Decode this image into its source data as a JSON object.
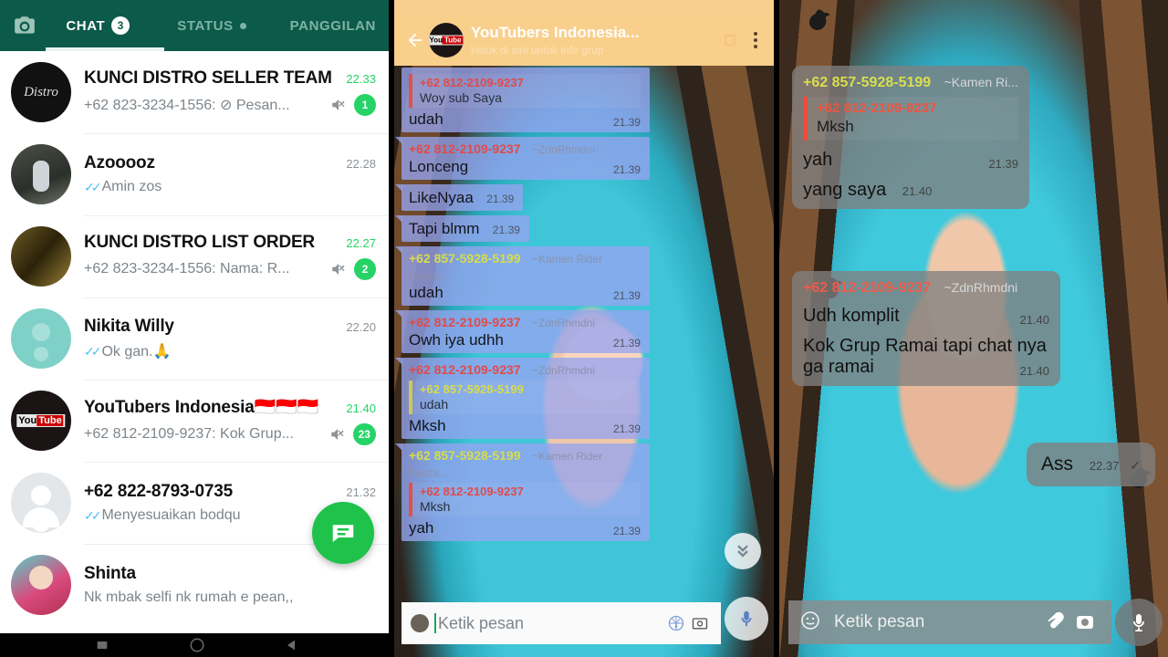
{
  "left_panel": {
    "header": {
      "camera_icon": "camera-icon",
      "tabs": [
        {
          "label": "CHAT",
          "badge": "3",
          "active": true
        },
        {
          "label": "STATUS",
          "dot": true,
          "active": false
        },
        {
          "label": "PANGGILAN",
          "active": false
        }
      ]
    },
    "chats": [
      {
        "name": "KUNCI DISTRO SELLER TEAM",
        "time": "22.33",
        "time_green": true,
        "preview": "+62 823-3234-1556: ⊘ Pesan...",
        "ticks": false,
        "muted": true,
        "unread": "1"
      },
      {
        "name": "Azooooz",
        "time": "22.28",
        "time_green": false,
        "preview": "Amin zos",
        "ticks": true,
        "muted": false,
        "unread": ""
      },
      {
        "name": "KUNCI DISTRO LIST ORDER",
        "time": "22.27",
        "time_green": true,
        "preview": "+62 823-3234-1556: Nama: R...",
        "ticks": false,
        "muted": true,
        "unread": "2"
      },
      {
        "name": "Nikita Willy",
        "time": "22.20",
        "time_green": false,
        "preview": "Ok gan.🙏",
        "ticks": true,
        "muted": false,
        "unread": ""
      },
      {
        "name": "YouTubers Indonesia🇮🇩🇮🇩🇮🇩",
        "time": "21.40",
        "time_green": true,
        "preview": "+62 812-2109-9237: Kok Grup...",
        "ticks": false,
        "muted": true,
        "unread": "23"
      },
      {
        "name": "+62 822-8793-0735",
        "time": "21.32",
        "time_green": false,
        "preview": "Menyesuaikan bodqu",
        "ticks": true,
        "muted": false,
        "unread": ""
      },
      {
        "name": "Shinta",
        "time": "",
        "time_green": false,
        "preview": "Nk mbak selfi nk rumah e pean,,",
        "ticks": false,
        "muted": false,
        "unread": ""
      }
    ],
    "fab": "new-chat-icon",
    "navbar": [
      "recents-icon",
      "home-icon",
      "back-icon"
    ]
  },
  "mid_panel": {
    "header": {
      "back_icon": "back-arrow-icon",
      "avatar": "youtube-logo",
      "title": "YouTubers Indonesia...",
      "subtitle": "ketuk di sini untuk info grup",
      "video_icon": "video-call-icon",
      "overflow_icon": "overflow-menu-icon"
    },
    "messages": [
      {
        "quote_sender": "+62 812-2109-9237",
        "quote_text": "Woy sub Saya",
        "quote_color": "red",
        "text": "udah",
        "time": "21.39",
        "wide": true,
        "tail": false
      },
      {
        "sender": "+62 812-2109-9237",
        "sender_color": "red",
        "push": "~ZdnRhmdni",
        "text": "Lonceng",
        "time": "21.39",
        "wide": true,
        "tail": true
      },
      {
        "text": "LikeNyaa",
        "time": "21.39",
        "tail": true
      },
      {
        "text": "Tapi blmm",
        "time": "21.39",
        "tail": true
      },
      {
        "sender": "+62 857-5928-5199",
        "sender_color": "yellow",
        "push": "~Kamen Rider Fauza...",
        "text": "udah",
        "time": "21.39",
        "wide": true,
        "tail": true
      },
      {
        "sender": "+62 812-2109-9237",
        "sender_color": "red",
        "push": "~ZdnRhmdni",
        "text": "Owh iya udhh",
        "time": "21.39",
        "wide": true,
        "tail": true
      },
      {
        "sender": "+62 812-2109-9237",
        "sender_color": "red",
        "push": "~ZdnRhmdni",
        "quote_sender": "+62 857-5928-5199",
        "quote_text": "udah",
        "quote_color": "yellow",
        "text": "Mksh",
        "time": "21.39",
        "wide": true,
        "tail": true
      },
      {
        "sender": "+62 857-5928-5199",
        "sender_color": "yellow",
        "push": "~Kamen Rider Fauza...",
        "quote_sender": "+62 812-2109-9237",
        "quote_text": "Mksh",
        "quote_color": "red",
        "text": "yah",
        "time": "21.39",
        "wide": true,
        "tail": true
      }
    ],
    "scroll_down_icon": "chevron-double-down-icon",
    "input": {
      "placeholder": "Ketik pesan",
      "emoji_icon": "emoji-icon",
      "sticker_icon": "sticker-icon",
      "camera_icon": "camera-icon",
      "mic_icon": "mic-icon"
    }
  },
  "right_panel": {
    "messages": [
      {
        "sender": "+62 857-5928-5199",
        "sender_color": "yellow",
        "push": "~Kamen Ri...",
        "quote_sender": "+62 812-2109-9237",
        "quote_text": "Mksh",
        "lines": [
          {
            "text": "yah",
            "time": "21.39",
            "far": true
          },
          {
            "text": "yang saya",
            "time": "21.40",
            "far": false
          }
        ]
      },
      {
        "sender": "+62 812-2109-9237",
        "sender_color": "red",
        "push": "~ZdnRhmdni",
        "lines": [
          {
            "text": "Udh komplit",
            "time": "21.40",
            "far": true
          },
          {
            "text": "Kok Grup Ramai tapi chat nya ga ramai",
            "time": "21.40",
            "far": true
          }
        ]
      }
    ],
    "outgoing": {
      "text": "Ass",
      "time": "22.37",
      "tick": "✓"
    },
    "input": {
      "placeholder": "Ketik pesan",
      "emoji_icon": "emoji-icon",
      "attach_icon": "paperclip-icon",
      "camera_icon": "camera-icon",
      "mic_icon": "mic-icon"
    }
  },
  "colors": {
    "wa_header_green": "#0c5a4a",
    "wa_accent_green": "#25d366",
    "mid_header_orange": "#f9cf8c",
    "mid_bubble_blue": "#96a4f0",
    "right_bubble_grey": "#808080",
    "sender_red": "#e24a4a",
    "sender_yellow": "#d9de4e"
  }
}
